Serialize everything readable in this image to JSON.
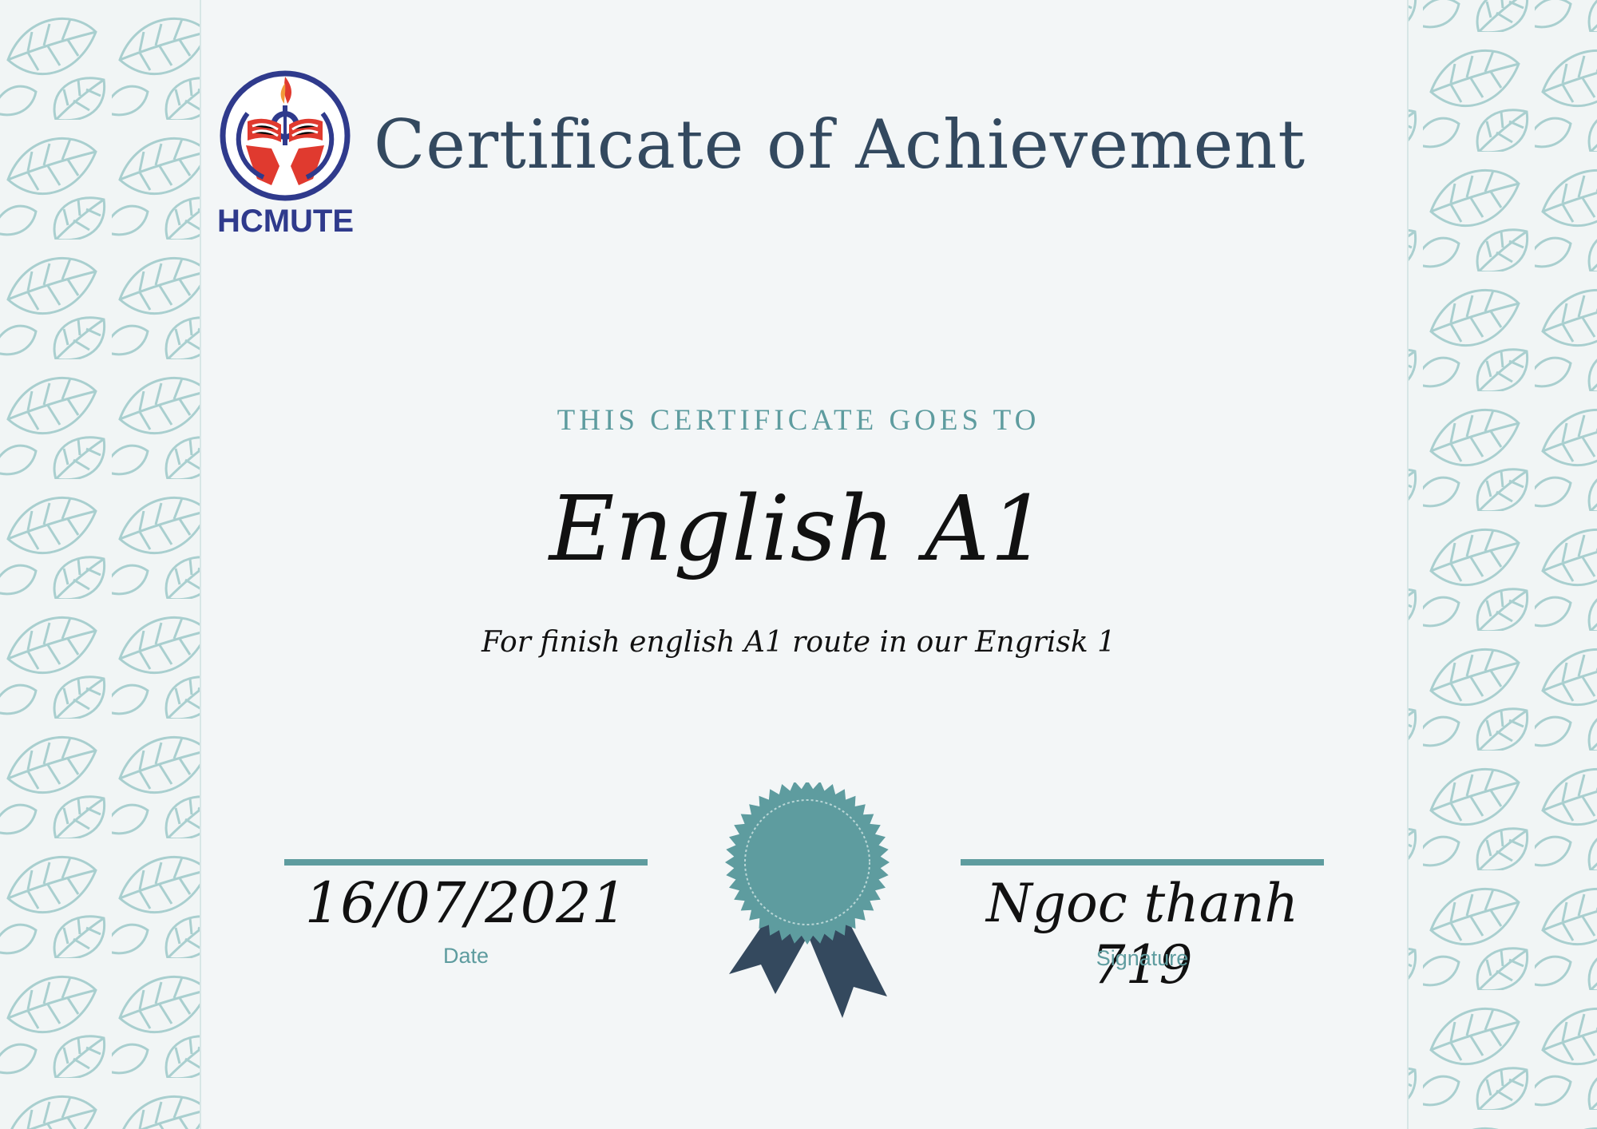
{
  "colors": {
    "background": "#f3f6f7",
    "title": "#33495f",
    "accent": "#5e9c9f",
    "ribbon": "#34495e",
    "logo_blue": "#2f3a8c",
    "logo_red": "#e03a2f",
    "leaf_pattern": "#a9cfcf"
  },
  "logo": {
    "icon": "hcmute-emblem-icon",
    "text": "HCMUTE"
  },
  "certificate": {
    "title": "Certificate of Achievement",
    "goes_to": "THIS CERTIFICATE GOES TO",
    "recipient": "English A1",
    "description": "For finish english A1 route in our Engrisk 1"
  },
  "footer": {
    "date_value": "16/07/2021",
    "date_label": "Date",
    "signature_value": "Ngoc thanh 719",
    "signature_label": "Signature"
  },
  "seal": {
    "icon": "award-seal-icon"
  }
}
